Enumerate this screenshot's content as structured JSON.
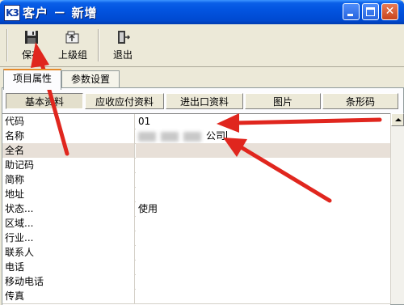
{
  "window": {
    "title": "客户 － 新增",
    "app_icon": "K3"
  },
  "toolbar": {
    "save_label": "保存",
    "up_label": "上级组",
    "exit_label": "退出"
  },
  "tabs": [
    {
      "label": "项目属性"
    },
    {
      "label": "参数设置"
    }
  ],
  "subtabs": [
    {
      "label": "基本资料"
    },
    {
      "label": "应收应付资料"
    },
    {
      "label": "进出口资料"
    },
    {
      "label": "图片"
    },
    {
      "label": "条形码"
    }
  ],
  "fields": [
    {
      "name": "代码",
      "value": "01"
    },
    {
      "name": "名称",
      "value": "公司"
    },
    {
      "name": "全名",
      "value": ""
    },
    {
      "name": "助记码",
      "value": ""
    },
    {
      "name": "简称",
      "value": ""
    },
    {
      "name": "地址",
      "value": ""
    },
    {
      "name": "状态...",
      "value": "使用"
    },
    {
      "name": "区域...",
      "value": ""
    },
    {
      "name": "行业...",
      "value": ""
    },
    {
      "name": "联系人",
      "value": ""
    },
    {
      "name": "电话",
      "value": ""
    },
    {
      "name": "移动电话",
      "value": ""
    },
    {
      "name": "传真",
      "value": ""
    }
  ],
  "colors": {
    "titlebar": "#0254e0",
    "arrow": "#e0261e",
    "selected_row": "#e8e0d8"
  },
  "icons": {
    "save": "floppy-disk-icon",
    "up": "folder-up-icon",
    "exit": "exit-door-icon"
  }
}
